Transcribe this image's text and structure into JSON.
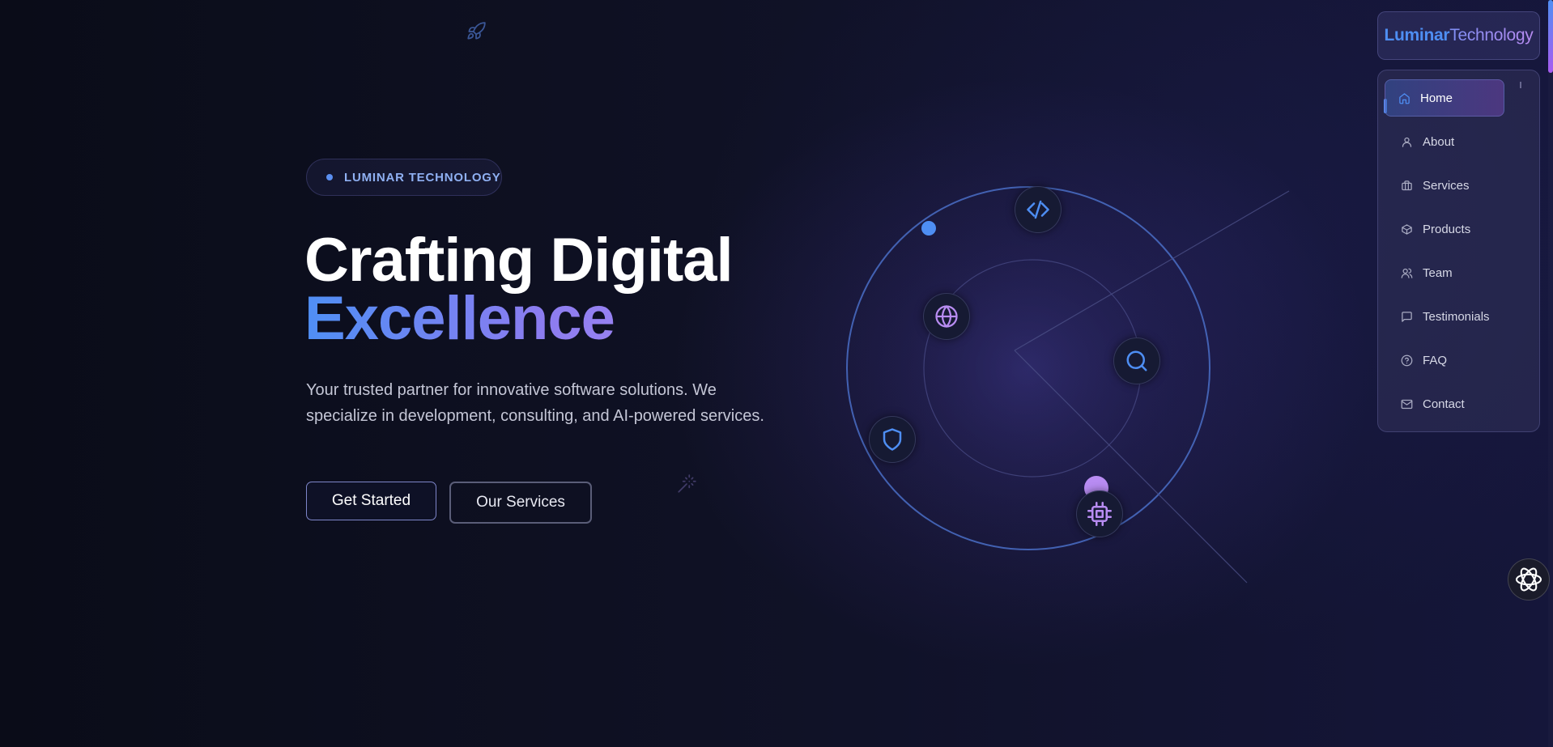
{
  "brand": {
    "name_bold": "Luminar",
    "name_light": "Technology"
  },
  "nav": {
    "items": [
      {
        "label": "Home",
        "icon": "home-icon",
        "active": true
      },
      {
        "label": "About",
        "icon": "user-icon"
      },
      {
        "label": "Services",
        "icon": "briefcase-icon"
      },
      {
        "label": "Products",
        "icon": "box-icon"
      },
      {
        "label": "Team",
        "icon": "users-icon"
      },
      {
        "label": "Testimonials",
        "icon": "message-icon"
      },
      {
        "label": "FAQ",
        "icon": "help-circle-icon"
      },
      {
        "label": "Contact",
        "icon": "mail-icon"
      }
    ]
  },
  "hero": {
    "badge": "LUMINAR TECHNOLOGY",
    "title_line1": "Crafting Digital",
    "title_line2": "Excellence",
    "subtitle": "Your trusted partner for innovative software solutions. We specialize in development, consulting, and AI-powered services.",
    "primary_cta": "Get Started",
    "secondary_cta": "Our Services"
  },
  "orbit": {
    "nodes": [
      "code-icon",
      "globe-icon",
      "search-icon",
      "shield-icon",
      "cpu-icon"
    ]
  },
  "colors": {
    "background": "#0c0e1c",
    "accent_blue": "#4e8ef3",
    "accent_purple": "#a98af4",
    "badge_text": "#8fb0f2"
  }
}
